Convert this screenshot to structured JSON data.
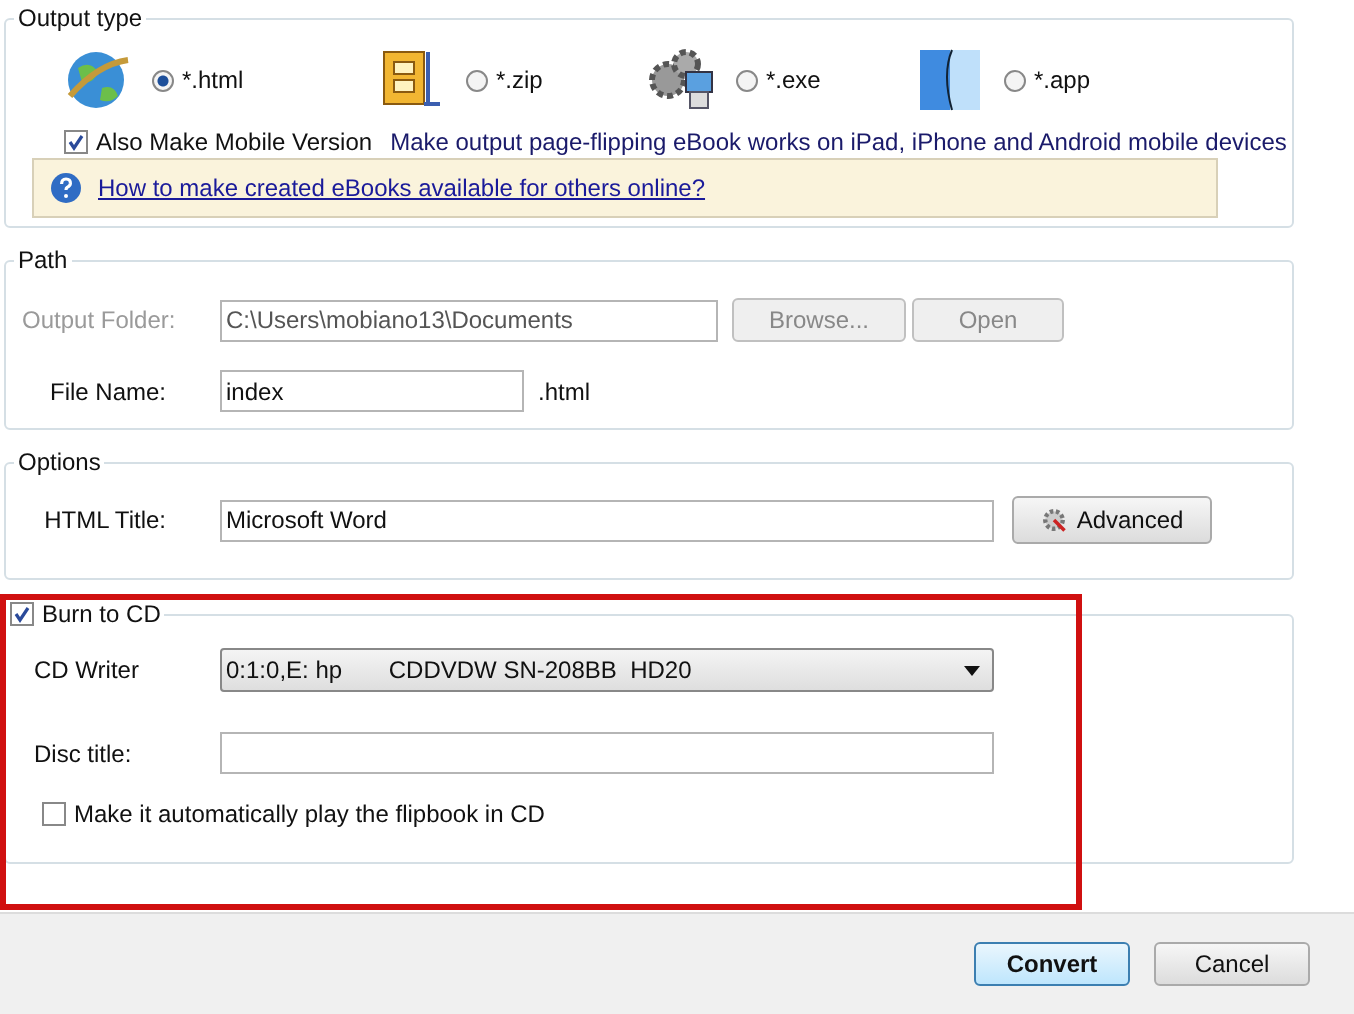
{
  "output_type": {
    "legend": "Output type",
    "options": [
      {
        "kind": "html",
        "label": "*.html",
        "selected": true
      },
      {
        "kind": "zip",
        "label": "*.zip",
        "selected": false
      },
      {
        "kind": "exe",
        "label": "*.exe",
        "selected": false
      },
      {
        "kind": "app",
        "label": "*.app",
        "selected": false
      }
    ],
    "mobile": {
      "label": "Also Make Mobile Version",
      "checked": true
    },
    "mobile_note": "Make output page-flipping eBook works on iPad, iPhone and Android mobile devices",
    "help_link": "How to make created eBooks available for others online?"
  },
  "path": {
    "legend": "Path",
    "output_folder": {
      "label": "Output Folder:",
      "value": "C:\\Users\\mobiano13\\Documents",
      "disabled": true
    },
    "buttons": [
      "Browse...",
      "Open"
    ],
    "file_name": {
      "label": "File Name:",
      "value": "index",
      "suffix": ".html"
    }
  },
  "options": {
    "legend": "Options",
    "html_title": {
      "label": "HTML Title:",
      "value": "Microsoft Word"
    },
    "advanced_button": "Advanced"
  },
  "burn": {
    "label": "Burn to CD",
    "checked": true,
    "cd_writer": {
      "label": "CD Writer",
      "value": "0:1:0,E: hp       CDDVDW SN-208BB  HD20"
    },
    "disc_title": {
      "label": "Disc title:"
    },
    "autoplay": {
      "label": "Make it automatically play the flipbook in CD",
      "checked": false
    }
  },
  "footer": {
    "convert": "Convert",
    "cancel": "Cancel"
  }
}
